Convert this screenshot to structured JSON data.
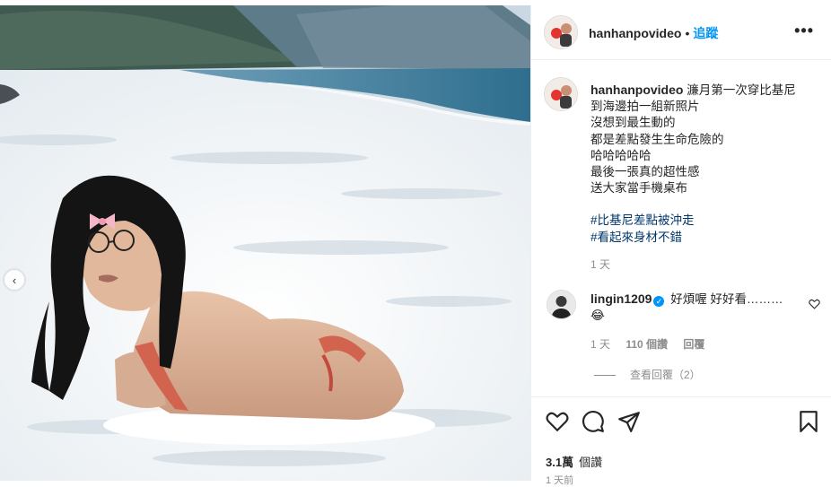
{
  "media": {
    "carousel_prev_icon": "chevron-left-icon"
  },
  "post": {
    "author": "hanhanpovideo",
    "dot": "•",
    "follow_label": "追蹤",
    "more_icon": "more-horizontal-icon",
    "more_glyph": "•••",
    "caption_lines": [
      "濂月第一次穿比基尼",
      "到海邊拍一組新照片",
      "沒想到最生動的",
      "都是差點發生生命危險的",
      "哈哈哈哈哈",
      "最後一張真的超性感",
      "送大家當手機桌布"
    ],
    "hashtags": [
      "#比基尼差點被沖走",
      "#看起來身材不錯"
    ],
    "caption_time": "1 天"
  },
  "comment": {
    "author": "lingin1209",
    "verified_icon": "verified-badge-icon",
    "verified_glyph": "✓",
    "text": "好煩喔 好好看………",
    "emoji": "😂",
    "like_icon": "heart-outline-icon",
    "time": "1 天",
    "likes": "110 個讚",
    "reply_label": "回覆",
    "view_replies": "查看回覆（2）"
  },
  "actions": {
    "like_icon": "heart-outline-icon",
    "comment_icon": "speech-bubble-icon",
    "share_icon": "paper-plane-icon",
    "save_icon": "bookmark-icon",
    "views_count": "3.1萬",
    "views_label": "個讚",
    "posted": "1 天前"
  },
  "colors": {
    "accent": "#0095f6",
    "text": "#262626",
    "muted": "#8e8e8e",
    "hashtag": "#00376b",
    "border": "#efefef"
  }
}
